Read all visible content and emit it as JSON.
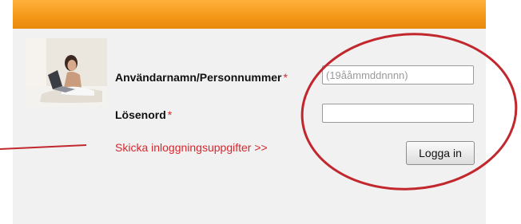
{
  "login": {
    "username_label": "Användarnamn/Personnummer",
    "username_required": "*",
    "username_placeholder": "(19ååmmddnnnn)",
    "username_value": "",
    "password_label": "Lösenord",
    "password_required": "*",
    "password_value": "",
    "send_credentials_link": "Skicka inloggningsuppgifter >>",
    "login_button": "Logga in"
  },
  "colors": {
    "header_orange": "#f39717",
    "panel_background": "#f1f1f1",
    "link_red": "#d9262c",
    "annotation_red": "#c1272d"
  },
  "icons": {
    "photo": "woman-with-laptop-photo"
  }
}
